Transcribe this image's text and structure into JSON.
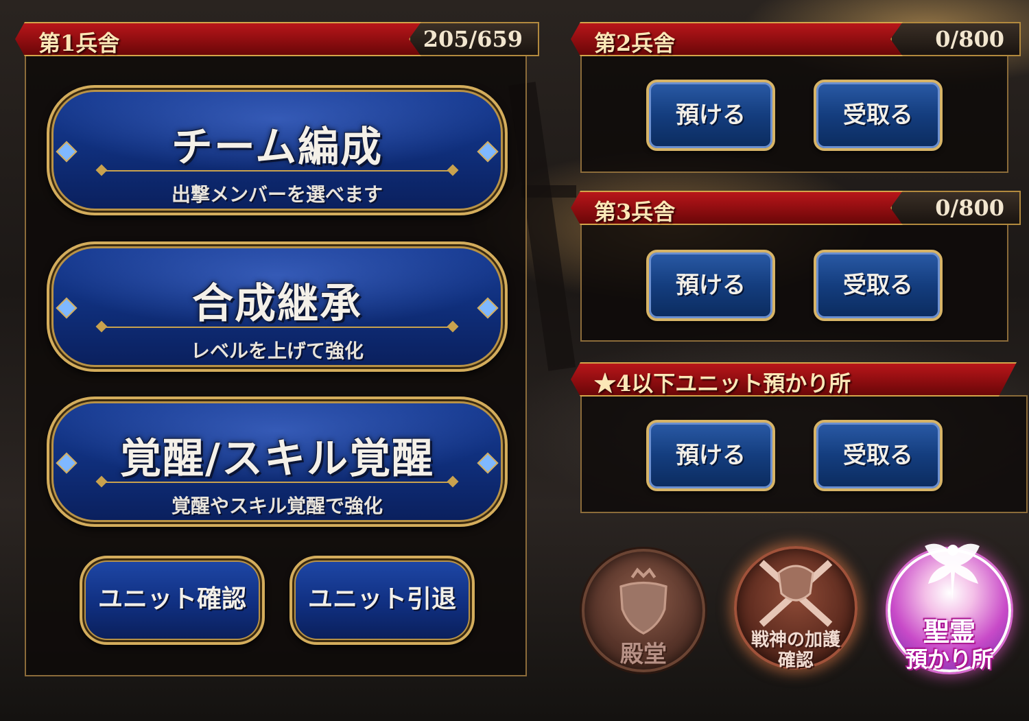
{
  "barracks": [
    {
      "title": "第1兵舎",
      "count": "205/659"
    },
    {
      "title": "第2兵舎",
      "count": "0/800",
      "deposit": "預ける",
      "withdraw": "受取る"
    },
    {
      "title": "第3兵舎",
      "count": "0/800",
      "deposit": "預ける",
      "withdraw": "受取る"
    },
    {
      "title": "★4以下ユニット預かり所",
      "deposit": "預ける",
      "withdraw": "受取る"
    }
  ],
  "menu": [
    {
      "title": "チーム編成",
      "subtitle": "出撃メンバーを選べます"
    },
    {
      "title": "合成継承",
      "subtitle": "レベルを上げて強化"
    },
    {
      "title": "覚醒/スキル覚醒",
      "subtitle": "覚醒やスキル覚醒で強化"
    }
  ],
  "unit_buttons": {
    "confirm": "ユニット確認",
    "retire": "ユニット引退"
  },
  "badges": {
    "hall": "殿堂",
    "war_god_line1": "戦神の加護",
    "war_god_line2": "確認",
    "spirit_line1": "聖霊",
    "spirit_line2": "預かり所"
  },
  "colors": {
    "header_red": "#8e0d10",
    "gold_trim": "#d4ad5c",
    "button_blue": "#10307e",
    "spirit_pink": "#e040c0"
  }
}
